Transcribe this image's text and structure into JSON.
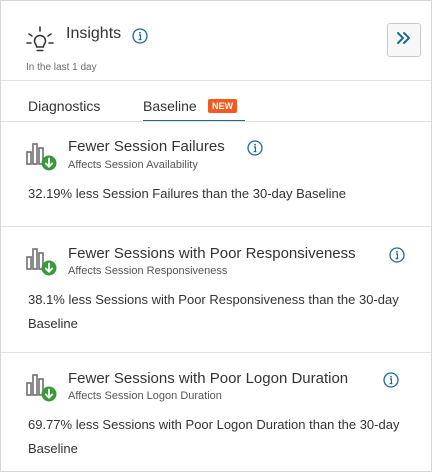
{
  "header": {
    "title": "Insights",
    "subtitle": "In the last 1 day"
  },
  "tabs": [
    {
      "label": "Diagnostics",
      "active": false
    },
    {
      "label": "Baseline",
      "active": true,
      "badge": "NEW"
    }
  ],
  "insights": [
    {
      "title": "Fewer Session Failures",
      "affects": "Affects Session Availability",
      "description": "32.19% less Session Failures than the 30-day Baseline"
    },
    {
      "title": "Fewer Sessions with Poor Responsiveness",
      "affects": "Affects Session Responsiveness",
      "description": "38.1% less Sessions with Poor Responsiveness than the 30-day Baseline"
    },
    {
      "title": "Fewer Sessions with Poor Logon Duration",
      "affects": "Affects Session Logon Duration",
      "description": "69.77% less Sessions with Poor Logon Duration than the 30-day Baseline"
    }
  ],
  "colors": {
    "accent": "#1b6d8c",
    "badge": "#f15a22",
    "trend_down": "#3a9a3a"
  },
  "icons": {
    "header": "lightbulb-icon",
    "info": "info-icon",
    "collapse": "double-chevron-right-icon",
    "insight": "bar-chart-trend-down-icon"
  }
}
